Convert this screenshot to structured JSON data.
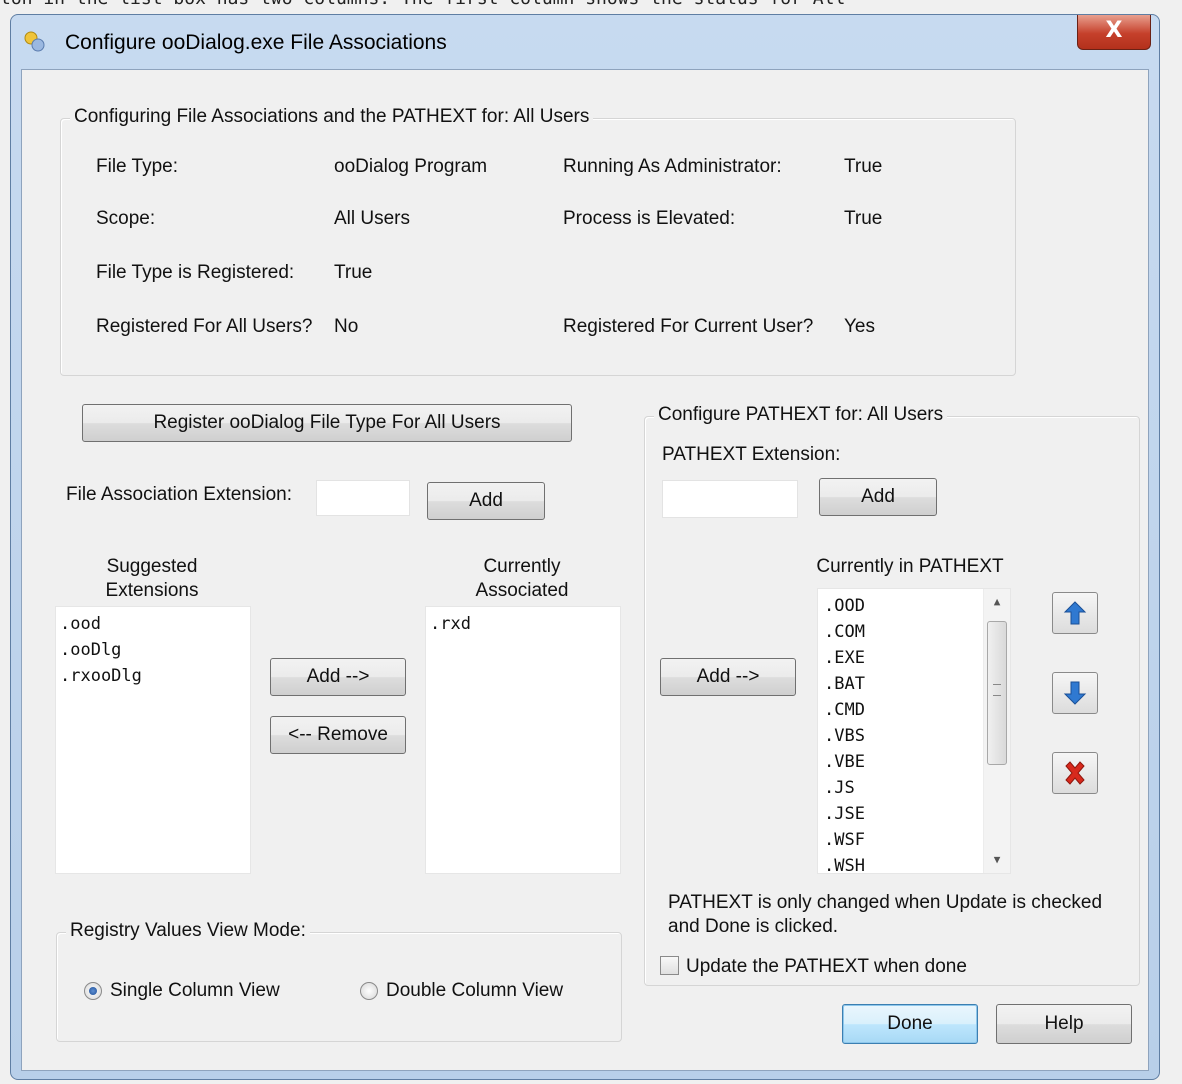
{
  "background_text": "ton in the list box has two columns. The first column shows the status for All",
  "window": {
    "title": "Configure ooDialog.exe File Associations",
    "close_label": "X"
  },
  "status_group": {
    "title": "Configuring File Associations and the PATHEXT for:  All Users",
    "file_type_label": "File Type:",
    "file_type_value": "ooDialog Program",
    "scope_label": "Scope:",
    "scope_value": "All Users",
    "registered_label": "File Type is Registered:",
    "registered_value": "True",
    "all_users_label": "Registered For All Users?",
    "all_users_value": "No",
    "admin_label": "Running As Administrator:",
    "admin_value": "True",
    "elevated_label": "Process is Elevated:",
    "elevated_value": "True",
    "current_user_label": "Registered For Current User?",
    "current_user_value": "Yes"
  },
  "register_button": "Register ooDialog File Type For All Users",
  "file_assoc": {
    "ext_label": "File Association Extension:",
    "ext_value": "",
    "add_label": "Add",
    "suggested_header_1": "Suggested",
    "suggested_header_2": "Extensions",
    "suggested_items": [
      ".ood",
      ".ooDlg",
      ".rxooDlg"
    ],
    "add_arrow_label": "Add -->",
    "remove_label": "<-- Remove",
    "current_header_1": "Currently",
    "current_header_2": "Associated",
    "current_items": [
      ".rxd"
    ]
  },
  "view_mode": {
    "title": "Registry Values View Mode:",
    "single_label": "Single Column View",
    "double_label": "Double Column View",
    "selected": "Single Column View"
  },
  "pathext": {
    "group_title": "Configure PATHEXT for:  All Users",
    "ext_label": "PATHEXT Extension:",
    "ext_value": "",
    "add_label": "Add",
    "add_arrow_label": "Add -->",
    "list_header": "Currently in PATHEXT",
    "items": [
      ".OOD",
      ".COM",
      ".EXE",
      ".BAT",
      ".CMD",
      ".VBS",
      ".VBE",
      ".JS",
      ".JSE",
      ".WSF",
      ".WSH"
    ],
    "note_line_1": "PATHEXT is only changed when Update is checked",
    "note_line_2": "and Done is clicked.",
    "update_label": "Update the PATHEXT when done",
    "update_checked": false,
    "icons": {
      "up": "arrow-up-icon",
      "down": "arrow-down-icon",
      "delete": "delete-x-icon"
    }
  },
  "buttons": {
    "done": "Done",
    "help": "Help"
  },
  "colors": {
    "accent_blue": "#2f79d1",
    "delete_red": "#d8291d"
  }
}
